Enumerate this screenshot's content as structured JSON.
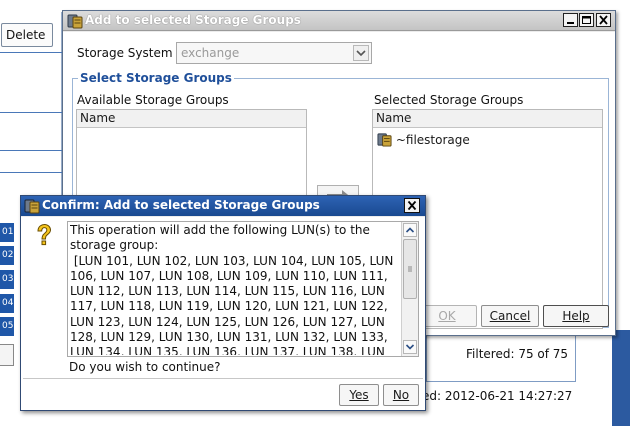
{
  "background": {
    "delete_label": "Delete",
    "row_numbers": [
      "01",
      "02",
      "03",
      "04",
      "05"
    ],
    "filtered": "Filtered: 75 of 75",
    "updated": "ed: 2012-06-21 14:27:27"
  },
  "add_dialog": {
    "title": "Add to selected Storage Groups",
    "storage_system_label": "Storage System",
    "storage_system_value": "exchange",
    "group_legend": "Select Storage Groups",
    "available_label": "Available Storage Groups",
    "selected_label": "Selected Storage Groups",
    "available_header": "Name",
    "selected_header": "Name",
    "selected_items": [
      "~filestorage"
    ],
    "ok_label": "OK",
    "cancel_label": "Cancel",
    "help_label": "Help"
  },
  "confirm_dialog": {
    "title": "Confirm: Add to selected Storage Groups",
    "message": "This operation will add the following LUN(s) to the storage group:\n [LUN 101, LUN 102, LUN 103, LUN 104, LUN 105, LUN 106, LUN 107, LUN 108, LUN 109, LUN 110, LUN 111, LUN 112, LUN 113, LUN 114, LUN 115, LUN 116, LUN 117, LUN 118, LUN 119, LUN 120, LUN 121, LUN 122, LUN 123, LUN 124, LUN 125, LUN 126, LUN 127, LUN 128, LUN 129, LUN 130, LUN 131, LUN 132, LUN 133, LUN 134, LUN 135, LUN 136, LUN 137, LUN 138, LUN",
    "continue_text": "Do you wish to continue?",
    "yes_label": "Yes",
    "no_label": "No"
  },
  "colors": {
    "confirm_title_bar": "#1f4f9a",
    "legend_text": "#1f4f9a",
    "row_number_bg": "#1f57a8"
  }
}
